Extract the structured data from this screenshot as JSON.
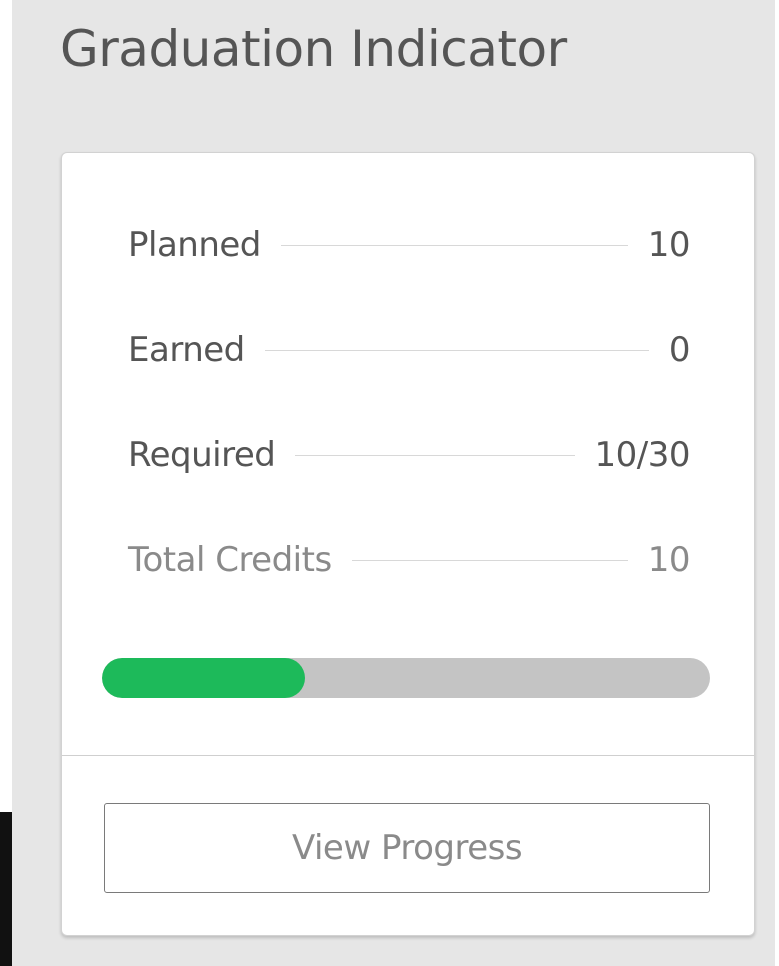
{
  "widget": {
    "title": "Graduation Indicator"
  },
  "stats": [
    {
      "label": "Planned",
      "value": "10"
    },
    {
      "label": "Earned",
      "value": "0"
    },
    {
      "label": "Required",
      "value": "10/30"
    },
    {
      "label": "Total Credits",
      "value": "10"
    }
  ],
  "progress": {
    "fraction": 0.3333,
    "fill_color": "#1dba5a",
    "track_color": "#c4c4c4"
  },
  "actions": {
    "view_progress_label": "View Progress"
  }
}
